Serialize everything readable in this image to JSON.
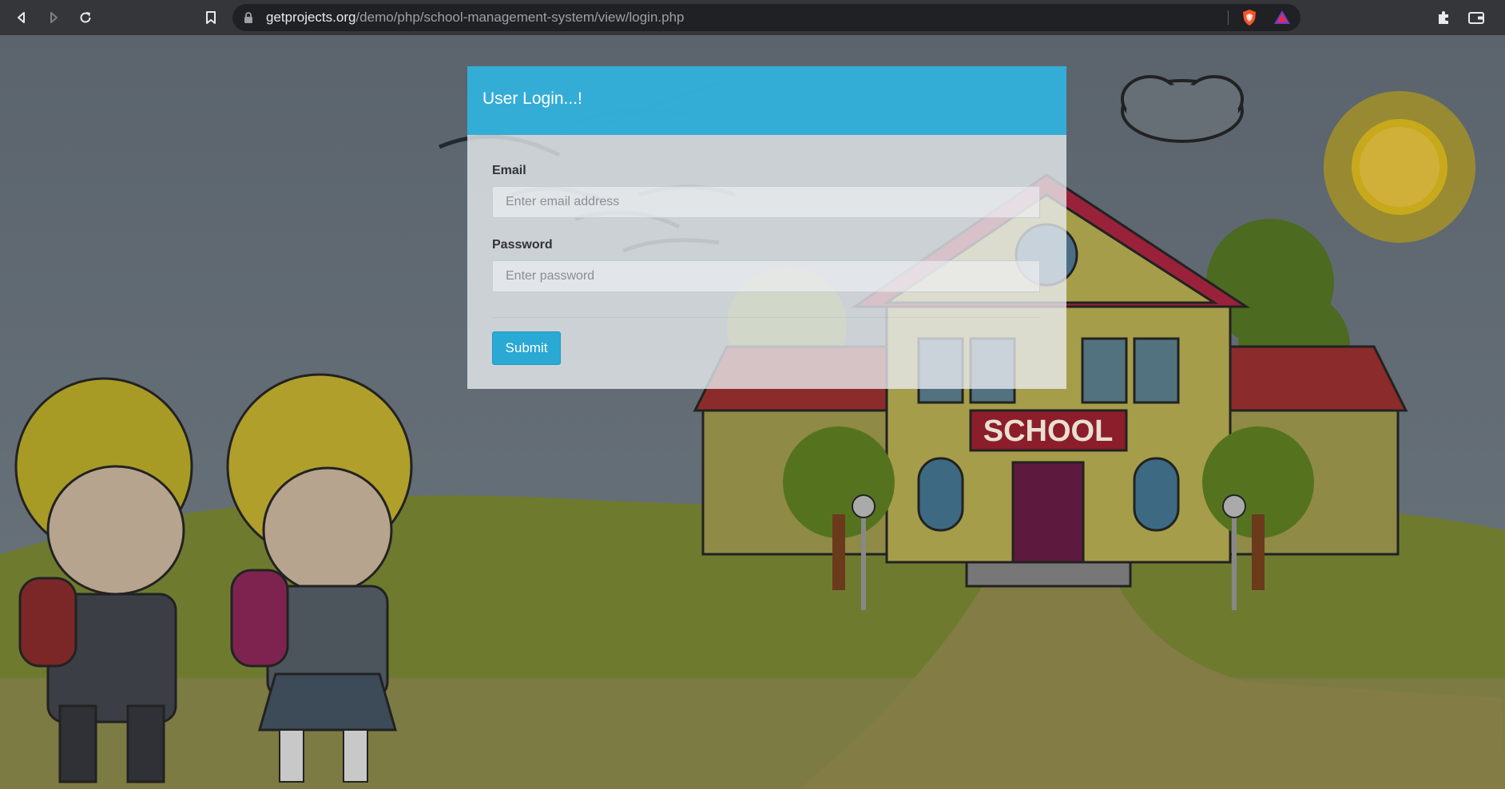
{
  "browser": {
    "url_host": "getprojects.org",
    "url_path": "/demo/php/school-management-system/view/login.php"
  },
  "login": {
    "title": "User Login...!",
    "email_label": "Email",
    "email_placeholder": "Enter email address",
    "password_label": "Password",
    "password_placeholder": "Enter password",
    "submit_label": "Submit"
  },
  "scene": {
    "school_sign": "SCHOOL"
  },
  "colors": {
    "toolbar": "#35363a",
    "omnibox": "#202124",
    "panel_header": "#2aa9d4",
    "submit_button": "#2aa9d4",
    "sky": "#5f6870",
    "grass": "#6d7a2e",
    "path": "#7f7a3e"
  },
  "icons": [
    "back-icon",
    "forward-icon",
    "reload-icon",
    "bookmark-icon",
    "lock-icon",
    "brave-shield-icon",
    "brave-rewards-icon",
    "extensions-icon",
    "wallet-icon"
  ]
}
